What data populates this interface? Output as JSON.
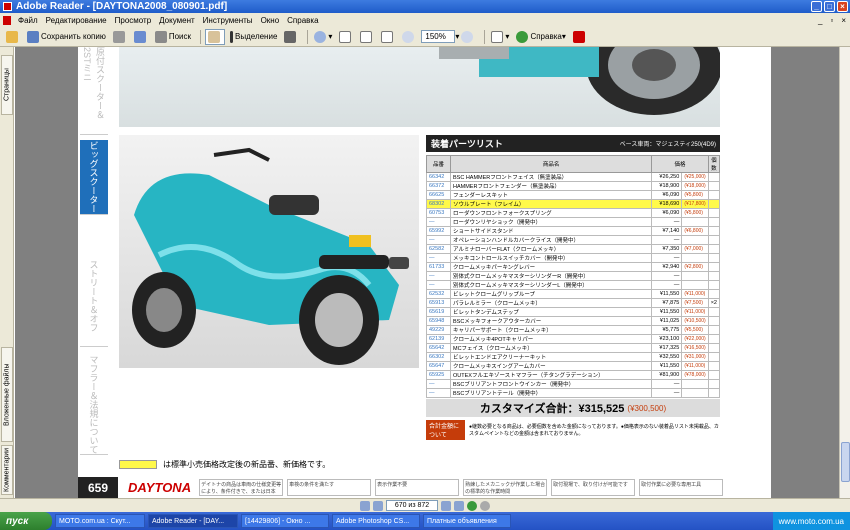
{
  "window": {
    "title": "Adobe Reader - [DAYTONA2008_080901.pdf]"
  },
  "menu": {
    "items": [
      "Файл",
      "Редактирование",
      "Просмотр",
      "Документ",
      "Инструменты",
      "Окно",
      "Справка"
    ]
  },
  "toolbar": {
    "save": "Сохранить копию",
    "search": "Поиск",
    "select": "Выделение",
    "zoom": "150%",
    "help": "Справка"
  },
  "left_tabs": {
    "pages": "Страницы",
    "attachments": "Вложенные файлы",
    "comments": "Комментарии"
  },
  "page": {
    "side_tabs": [
      "原付スクーター＆2STミニ",
      "ビッグスクーター",
      "ストリート＆オフ",
      "マフラー＆法規について"
    ],
    "parts_title": "装着パーツリスト",
    "parts_subtitle": "ベース車両：マジェスティ250(4D9)",
    "columns": [
      "品番",
      "商品名",
      "価格",
      "個数"
    ],
    "rows": [
      {
        "code": "66342",
        "name": "BSC HAMMERフロントフェイス（無塗装品）",
        "price": "¥26,250",
        "retail": "(¥25,000)",
        "qty": ""
      },
      {
        "code": "66372",
        "name": "HAMMERフロントフェンダー（無塗装品）",
        "price": "¥18,900",
        "retail": "(¥18,000)",
        "qty": ""
      },
      {
        "code": "66625",
        "name": "フェンダーレスキット",
        "price": "¥6,090",
        "retail": "(¥5,800)",
        "qty": ""
      },
      {
        "code": "68302",
        "name": "ソウルプレート（フレイム）",
        "price": "¥18,690",
        "retail": "(¥17,800)",
        "qty": "",
        "hl": true
      },
      {
        "code": "60753",
        "name": "ローダウンフロントフォークスプリング",
        "price": "¥6,090",
        "retail": "(¥5,800)",
        "qty": ""
      },
      {
        "code": "—",
        "name": "ローダウンリヤショック（開発中）",
        "price": "—",
        "retail": "",
        "qty": ""
      },
      {
        "code": "65992",
        "name": "ショートサイドスタンド",
        "price": "¥7,140",
        "retail": "(¥6,800)",
        "qty": ""
      },
      {
        "code": "—",
        "name": "オペレーションハンドルカバークライス（開発中）",
        "price": "—",
        "retail": "",
        "qty": ""
      },
      {
        "code": "62582",
        "name": "アルミナローバーFLAT（クロームメッキ）",
        "price": "¥7,350",
        "retail": "(¥7,000)",
        "qty": ""
      },
      {
        "code": "—",
        "name": "メッキコントロールスイッチカバー（開発中）",
        "price": "—",
        "retail": "",
        "qty": ""
      },
      {
        "code": "61733",
        "name": "クロームメッキパーキングレバー",
        "price": "¥2,940",
        "retail": "(¥2,800)",
        "qty": ""
      },
      {
        "code": "—",
        "name": "別体式クロームメッキマスターシリンダーR（開発中）",
        "price": "—",
        "retail": "",
        "qty": ""
      },
      {
        "code": "—",
        "name": "別体式クロームメッキマスターシリンダーL（開発中）",
        "price": "—",
        "retail": "",
        "qty": ""
      },
      {
        "code": "62532",
        "name": "ビレットクロームグリップループ",
        "price": "¥11,550",
        "retail": "(¥11,000)",
        "qty": ""
      },
      {
        "code": "65913",
        "name": "パラレルミラー（クロームメッキ）",
        "price": "¥7,875",
        "retail": "(¥7,500)",
        "qty": "×2"
      },
      {
        "code": "65619",
        "name": "ビレットタンデムステップ",
        "price": "¥11,550",
        "retail": "(¥11,000)",
        "qty": ""
      },
      {
        "code": "65948",
        "name": "BSCメッキフォークアウターカバー",
        "price": "¥11,025",
        "retail": "(¥10,500)",
        "qty": ""
      },
      {
        "code": "49229",
        "name": "キャリパーサポート（クロームメッキ）",
        "price": "¥5,775",
        "retail": "(¥5,500)",
        "qty": ""
      },
      {
        "code": "62139",
        "name": "クロームメッキ4POTキャリパー",
        "price": "¥23,100",
        "retail": "(¥22,000)",
        "qty": ""
      },
      {
        "code": "65642",
        "name": "MCフェイス（クロームメッキ）",
        "price": "¥17,325",
        "retail": "(¥16,500)",
        "qty": ""
      },
      {
        "code": "66302",
        "name": "ビレットエンドエアクリーナーキット",
        "price": "¥32,550",
        "retail": "(¥31,000)",
        "qty": ""
      },
      {
        "code": "65647",
        "name": "クロームメッキスイングアームカバー",
        "price": "¥11,550",
        "retail": "(¥11,000)",
        "qty": ""
      },
      {
        "code": "65925",
        "name": "OUTEXフルエキゾーストマフラー（チタングラデーション）",
        "price": "¥81,900",
        "retail": "(¥78,000)",
        "qty": ""
      },
      {
        "code": "—",
        "name": "BSCブリリアントフロントウインカー（開発中）",
        "price": "—",
        "retail": "",
        "qty": ""
      },
      {
        "code": "—",
        "name": "BSCブリリアントテール（開発中）",
        "price": "—",
        "retail": "",
        "qty": ""
      }
    ],
    "total_label": "カスタマイズ合計：¥315,525",
    "total_retail": "(¥300,500)",
    "note_label": "合計金額について",
    "note_text": "●継数必要となる商品は、必要個数を含めた金額になっております。●価格表示のない装着品リスト未掲載品、カスタムペイントなどの金額は含まれておりません。",
    "legend_text": "は標準小売価格改定後の新品番、新価格です。",
    "page_number": "659",
    "brand": "DAYTONA",
    "footer_boxes": [
      "デイトナの商品は車両の仕様変更等により、条件付きで、または日本",
      "車検の条件を満たす",
      "表示作業不要",
      "熟練したメカニックが作業した場合の標準的な作業時間",
      "取付現場で、取り付けが可能です",
      "取付作業に必要な専用工具"
    ]
  },
  "status": {
    "page_field": "670 из 872"
  },
  "taskbar": {
    "start": "пуск",
    "tasks": [
      "MOTO.com.ua : Скут...",
      "Adobe Reader - [DAY...",
      "[14429806] - Окно ...",
      "Adobe Photoshop CS...",
      "Платные объявления"
    ],
    "tray": "www.moto.com.ua"
  }
}
